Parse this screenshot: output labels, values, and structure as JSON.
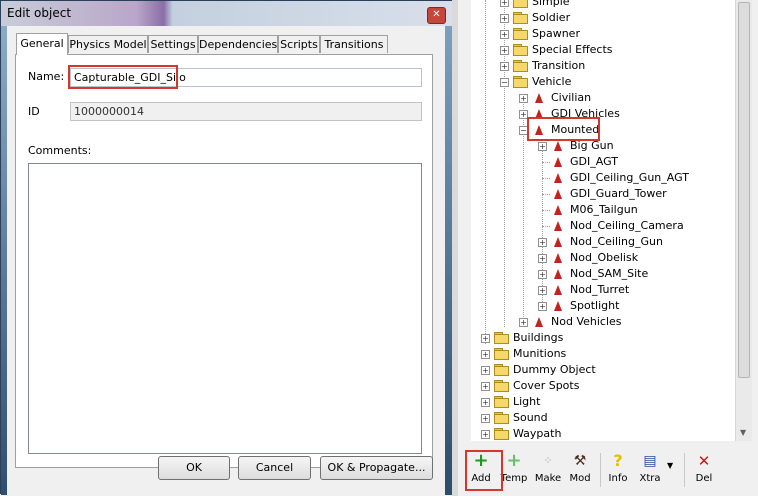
{
  "dialog": {
    "title": "Edit object",
    "close_glyph": "✕",
    "tabs": [
      "General",
      "Physics Model",
      "Settings",
      "Dependencies",
      "Scripts",
      "Transitions"
    ],
    "name_label": "Name:",
    "name_value": "Capturable_GDI_Silo",
    "id_label": "ID",
    "id_value": "1000000014",
    "comments_label": "Comments:",
    "comments_value": "",
    "buttons": {
      "ok": "OK",
      "cancel": "Cancel",
      "ok_propagate": "OK & Propagate..."
    }
  },
  "tree": {
    "items": [
      {
        "label": "Simple",
        "icon": "folder-icon",
        "expander": "+"
      },
      {
        "label": "Soldier",
        "icon": "folder-icon",
        "expander": "+"
      },
      {
        "label": "Spawner",
        "icon": "folder-icon",
        "expander": "+"
      },
      {
        "label": "Special Effects",
        "icon": "folder-icon",
        "expander": "+"
      },
      {
        "label": "Transition",
        "icon": "folder-icon",
        "expander": "+"
      },
      {
        "label": "Vehicle",
        "icon": "folder-icon",
        "expander": "−"
      },
      {
        "label": "Civilian",
        "icon": "vehicle-icon",
        "expander": "+"
      },
      {
        "label": "GDI Vehicles",
        "icon": "vehicle-icon",
        "expander": "+"
      },
      {
        "label": "Mounted",
        "icon": "vehicle-icon",
        "expander": "−"
      },
      {
        "label": "Big Gun",
        "icon": "vehicle-icon",
        "expander": "+"
      },
      {
        "label": "GDI_AGT",
        "icon": "vehicle-icon",
        "expander": ""
      },
      {
        "label": "GDI_Ceiling_Gun_AGT",
        "icon": "vehicle-icon",
        "expander": ""
      },
      {
        "label": "GDI_Guard_Tower",
        "icon": "vehicle-icon",
        "expander": ""
      },
      {
        "label": "M06_Tailgun",
        "icon": "vehicle-icon",
        "expander": ""
      },
      {
        "label": "Nod_Ceiling_Camera",
        "icon": "vehicle-icon",
        "expander": ""
      },
      {
        "label": "Nod_Ceiling_Gun",
        "icon": "vehicle-icon",
        "expander": "+"
      },
      {
        "label": "Nod_Obelisk",
        "icon": "vehicle-icon",
        "expander": "+"
      },
      {
        "label": "Nod_SAM_Site",
        "icon": "vehicle-icon",
        "expander": "+"
      },
      {
        "label": "Nod_Turret",
        "icon": "vehicle-icon",
        "expander": "+"
      },
      {
        "label": "Spotlight",
        "icon": "vehicle-icon",
        "expander": "+"
      },
      {
        "label": "Nod Vehicles",
        "icon": "vehicle-icon",
        "expander": "+"
      },
      {
        "label": "Buildings",
        "icon": "folder-icon",
        "expander": "+"
      },
      {
        "label": "Munitions",
        "icon": "folder-icon",
        "expander": "+"
      },
      {
        "label": "Dummy Object",
        "icon": "folder-icon",
        "expander": "+"
      },
      {
        "label": "Cover Spots",
        "icon": "folder-icon",
        "expander": "+"
      },
      {
        "label": "Light",
        "icon": "folder-icon",
        "expander": "+"
      },
      {
        "label": "Sound",
        "icon": "folder-icon",
        "expander": "+"
      },
      {
        "label": "Waypath",
        "icon": "folder-icon",
        "expander": "+"
      }
    ]
  },
  "toolbar": {
    "add": "Add",
    "temp": "Temp",
    "make": "Make",
    "mod": "Mod",
    "info": "Info",
    "xtra": "Xtra",
    "del": "Del"
  },
  "colors": {
    "highlight": "#d2382c",
    "folder": "#f4d86c",
    "vehicle": "#c0241c"
  }
}
